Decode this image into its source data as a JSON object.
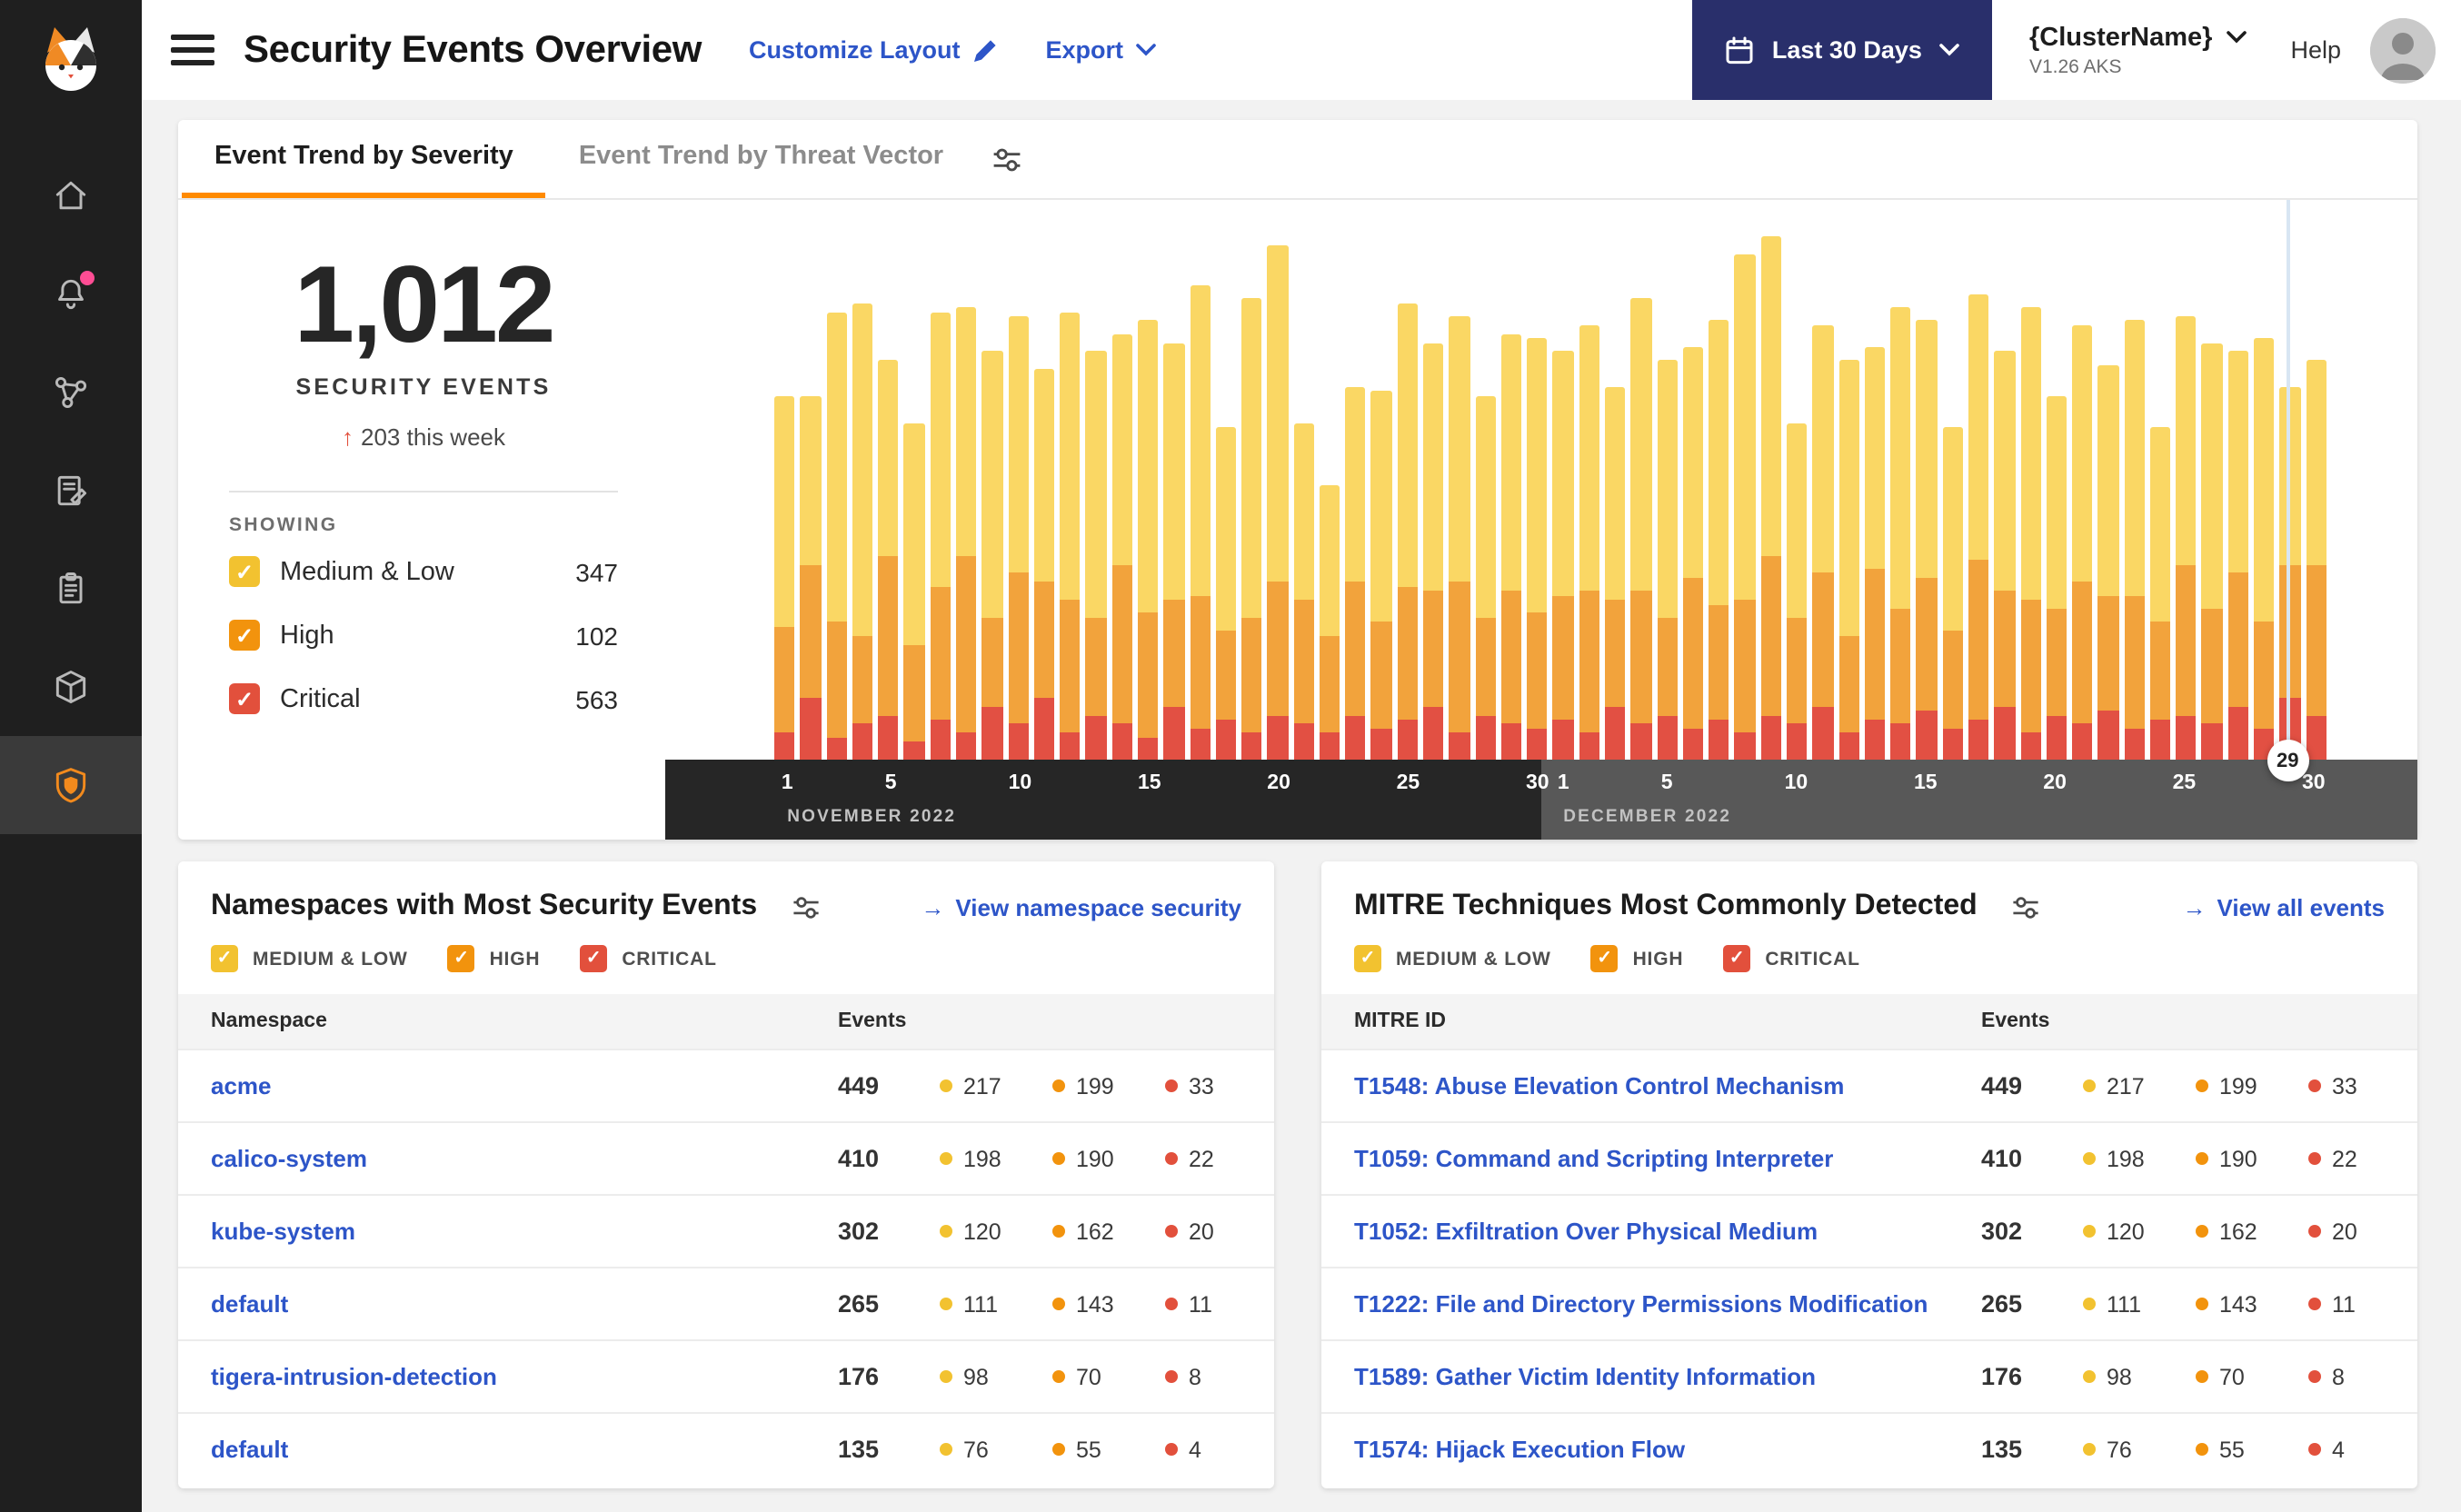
{
  "icons": {
    "check": "✓",
    "up_arrow": "↑",
    "link_arrow": "→"
  },
  "colors": {
    "medium": "#F2C230",
    "high": "#F2930D",
    "critical": "#E2503C",
    "bar_medium": "#FAD764",
    "bar_high": "#F2A33C",
    "bar_critical": "#E25043",
    "link_blue": "#2D55C8",
    "tab_orange": "#FF8A00",
    "button_navy": "#292F6B"
  },
  "header": {
    "title": "Security Events Overview",
    "customize_layout": "Customize Layout",
    "export_label": "Export",
    "date_range_label": "Last 30 Days",
    "cluster_name": "{ClusterName}",
    "cluster_version": "V1.26 AKS",
    "help_label": "Help"
  },
  "tabs": {
    "severity": "Event Trend by Severity",
    "threat_vector": "Event Trend by Threat Vector"
  },
  "stats": {
    "total": "1,012",
    "total_label": "SECURITY EVENTS",
    "delta": "203 this week",
    "showing_label": "SHOWING",
    "filters": [
      {
        "key": "medium",
        "label": "Medium & Low",
        "count": 347,
        "checked": true
      },
      {
        "key": "high",
        "label": "High",
        "count": 102,
        "checked": true
      },
      {
        "key": "critical",
        "label": "Critical",
        "count": 563,
        "checked": true
      }
    ]
  },
  "chart_data": {
    "type": "bar",
    "stacked": true,
    "title": "Security events per day by severity",
    "y_axis": {
      "visible": false
    },
    "categories": [
      "Nov 1",
      "Nov 2",
      "Nov 3",
      "Nov 4",
      "Nov 5",
      "Nov 6",
      "Nov 7",
      "Nov 8",
      "Nov 9",
      "Nov 10",
      "Nov 11",
      "Nov 12",
      "Nov 13",
      "Nov 14",
      "Nov 15",
      "Nov 16",
      "Nov 17",
      "Nov 18",
      "Nov 19",
      "Nov 20",
      "Nov 21",
      "Nov 22",
      "Nov 23",
      "Nov 24",
      "Nov 25",
      "Nov 26",
      "Nov 27",
      "Nov 28",
      "Nov 29",
      "Nov 30",
      "Dec 1",
      "Dec 2",
      "Dec 3",
      "Dec 4",
      "Dec 5",
      "Dec 6",
      "Dec 7",
      "Dec 8",
      "Dec 9",
      "Dec 10",
      "Dec 11",
      "Dec 12",
      "Dec 13",
      "Dec 14",
      "Dec 15",
      "Dec 16",
      "Dec 17",
      "Dec 18",
      "Dec 19",
      "Dec 20",
      "Dec 21",
      "Dec 22",
      "Dec 23",
      "Dec 24",
      "Dec 25",
      "Dec 26",
      "Dec 27",
      "Dec 28",
      "Dec 29",
      "Dec 30"
    ],
    "series": [
      {
        "name": "Medium & Low",
        "key": "medium",
        "values": [
          52,
          38,
          70,
          75,
          44,
          50,
          62,
          56,
          60,
          58,
          48,
          65,
          60,
          52,
          66,
          58,
          70,
          46,
          72,
          76,
          40,
          34,
          44,
          52,
          64,
          56,
          60,
          50,
          58,
          62,
          55,
          60,
          48,
          66,
          58,
          52,
          64,
          78,
          72,
          44,
          56,
          62,
          50,
          68,
          58,
          46,
          60,
          54,
          66,
          48,
          58,
          52,
          62,
          44,
          56,
          60,
          50,
          64,
          40,
          46
        ]
      },
      {
        "name": "High",
        "key": "high",
        "values": [
          24,
          30,
          26,
          20,
          36,
          22,
          30,
          40,
          20,
          34,
          26,
          30,
          22,
          36,
          28,
          24,
          30,
          20,
          26,
          30,
          28,
          22,
          30,
          24,
          30,
          26,
          34,
          22,
          30,
          26,
          28,
          32,
          24,
          30,
          22,
          34,
          26,
          30,
          36,
          24,
          30,
          22,
          34,
          26,
          30,
          22,
          36,
          26,
          30,
          24,
          32,
          26,
          30,
          22,
          34,
          26,
          30,
          24,
          30,
          34
        ]
      },
      {
        "name": "Critical",
        "key": "critical",
        "values": [
          6,
          14,
          5,
          8,
          10,
          4,
          9,
          6,
          12,
          8,
          14,
          6,
          10,
          8,
          5,
          12,
          7,
          9,
          6,
          10,
          8,
          6,
          10,
          7,
          9,
          12,
          6,
          10,
          8,
          7,
          9,
          6,
          12,
          8,
          10,
          7,
          9,
          6,
          10,
          8,
          12,
          6,
          9,
          8,
          11,
          7,
          9,
          12,
          6,
          10,
          8,
          11,
          7,
          9,
          10,
          8,
          12,
          7,
          14,
          10
        ]
      }
    ],
    "x_axis": {
      "months": [
        {
          "label": "NOVEMBER 2022",
          "ticks": [
            1,
            5,
            10,
            15,
            20,
            25,
            30
          ]
        },
        {
          "label": "DECEMBER 2022",
          "ticks": [
            1,
            5,
            10,
            15,
            20,
            25,
            30
          ]
        }
      ],
      "selected": {
        "month_index": 1,
        "day": 29
      }
    }
  },
  "namespaces_card": {
    "title": "Namespaces with Most Security Events",
    "link": "View namespace security",
    "filters": [
      {
        "key": "medium",
        "label": "MEDIUM & LOW",
        "checked": true
      },
      {
        "key": "high",
        "label": "HIGH",
        "checked": true
      },
      {
        "key": "critical",
        "label": "CRITICAL",
        "checked": true
      }
    ],
    "columns": [
      "Namespace",
      "Events"
    ],
    "rows": [
      {
        "name": "acme",
        "total": 449,
        "medium": 217,
        "high": 199,
        "critical": 33
      },
      {
        "name": "calico-system",
        "total": 410,
        "medium": 198,
        "high": 190,
        "critical": 22
      },
      {
        "name": "kube-system",
        "total": 302,
        "medium": 120,
        "high": 162,
        "critical": 20
      },
      {
        "name": "default",
        "total": 265,
        "medium": 111,
        "high": 143,
        "critical": 11
      },
      {
        "name": "tigera-intrusion-detection",
        "total": 176,
        "medium": 98,
        "high": 70,
        "critical": 8
      },
      {
        "name": "default",
        "total": 135,
        "medium": 76,
        "high": 55,
        "critical": 4
      }
    ]
  },
  "mitre_card": {
    "title": "MITRE Techniques Most Commonly Detected",
    "link": "View all events",
    "filters": [
      {
        "key": "medium",
        "label": "MEDIUM & LOW",
        "checked": true
      },
      {
        "key": "high",
        "label": "HIGH",
        "checked": true
      },
      {
        "key": "critical",
        "label": "CRITICAL",
        "checked": true
      }
    ],
    "columns": [
      "MITRE ID",
      "Events"
    ],
    "rows": [
      {
        "name": "T1548: Abuse Elevation Control Mechanism",
        "total": 449,
        "medium": 217,
        "high": 199,
        "critical": 33
      },
      {
        "name": "T1059: Command and Scripting Interpreter",
        "total": 410,
        "medium": 198,
        "high": 190,
        "critical": 22
      },
      {
        "name": "T1052: Exfiltration Over Physical Medium",
        "total": 302,
        "medium": 120,
        "high": 162,
        "critical": 20
      },
      {
        "name": "T1222: File and Directory Permissions Modification",
        "total": 265,
        "medium": 111,
        "high": 143,
        "critical": 11
      },
      {
        "name": "T1589: Gather Victim Identity Information",
        "total": 176,
        "medium": 98,
        "high": 70,
        "critical": 8
      },
      {
        "name": "T1574: Hijack Execution Flow",
        "total": 135,
        "medium": 76,
        "high": 55,
        "critical": 4
      }
    ]
  }
}
